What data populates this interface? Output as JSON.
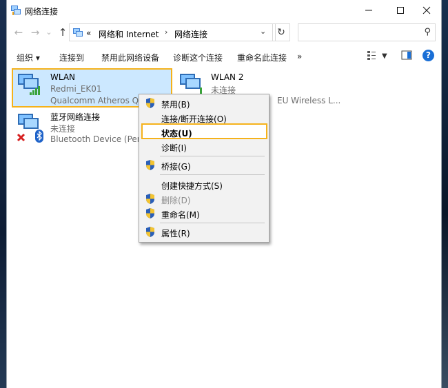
{
  "window": {
    "title": "网络连接"
  },
  "address": {
    "chevron": "«",
    "crumbs": [
      "网络和 Internet",
      "网络连接"
    ],
    "search_placeholder": ""
  },
  "toolbar": {
    "items": [
      "组织 ▾",
      "连接到",
      "禁用此网络设备",
      "诊断这个连接",
      "重命名此连接",
      "»"
    ]
  },
  "connections": [
    {
      "name": "WLAN",
      "network": "Redmi_EK01",
      "device": "Qualcomm Atheros QCA",
      "selected": true
    },
    {
      "name": "WLAN 2",
      "network": "未连接",
      "device": "EU Wireless L...",
      "selected": false
    },
    {
      "name": "蓝牙网络连接",
      "network": "未连接",
      "device": "Bluetooth Device (Perso",
      "selected": false
    }
  ],
  "context_menu": {
    "items": [
      {
        "label": "禁用(B)",
        "shield": true,
        "disabled": false,
        "bold": false
      },
      {
        "label": "连接/断开连接(O)",
        "shield": false,
        "disabled": false,
        "bold": false
      },
      {
        "label": "状态(U)",
        "shield": false,
        "disabled": false,
        "bold": true,
        "highlighted": true
      },
      {
        "label": "诊断(I)",
        "shield": false,
        "disabled": false,
        "bold": false
      },
      {
        "label": "桥接(G)",
        "shield": true,
        "disabled": false,
        "bold": false
      },
      {
        "label": "创建快捷方式(S)",
        "shield": false,
        "disabled": false,
        "bold": false
      },
      {
        "label": "删除(D)",
        "shield": true,
        "disabled": true,
        "bold": false
      },
      {
        "label": "重命名(M)",
        "shield": true,
        "disabled": false,
        "bold": false
      },
      {
        "label": "属性(R)",
        "shield": true,
        "disabled": false,
        "bold": false
      }
    ]
  },
  "colors": {
    "highlight": "#f5b21b",
    "selection": "#cce8ff",
    "help": "#1a6fd6"
  }
}
